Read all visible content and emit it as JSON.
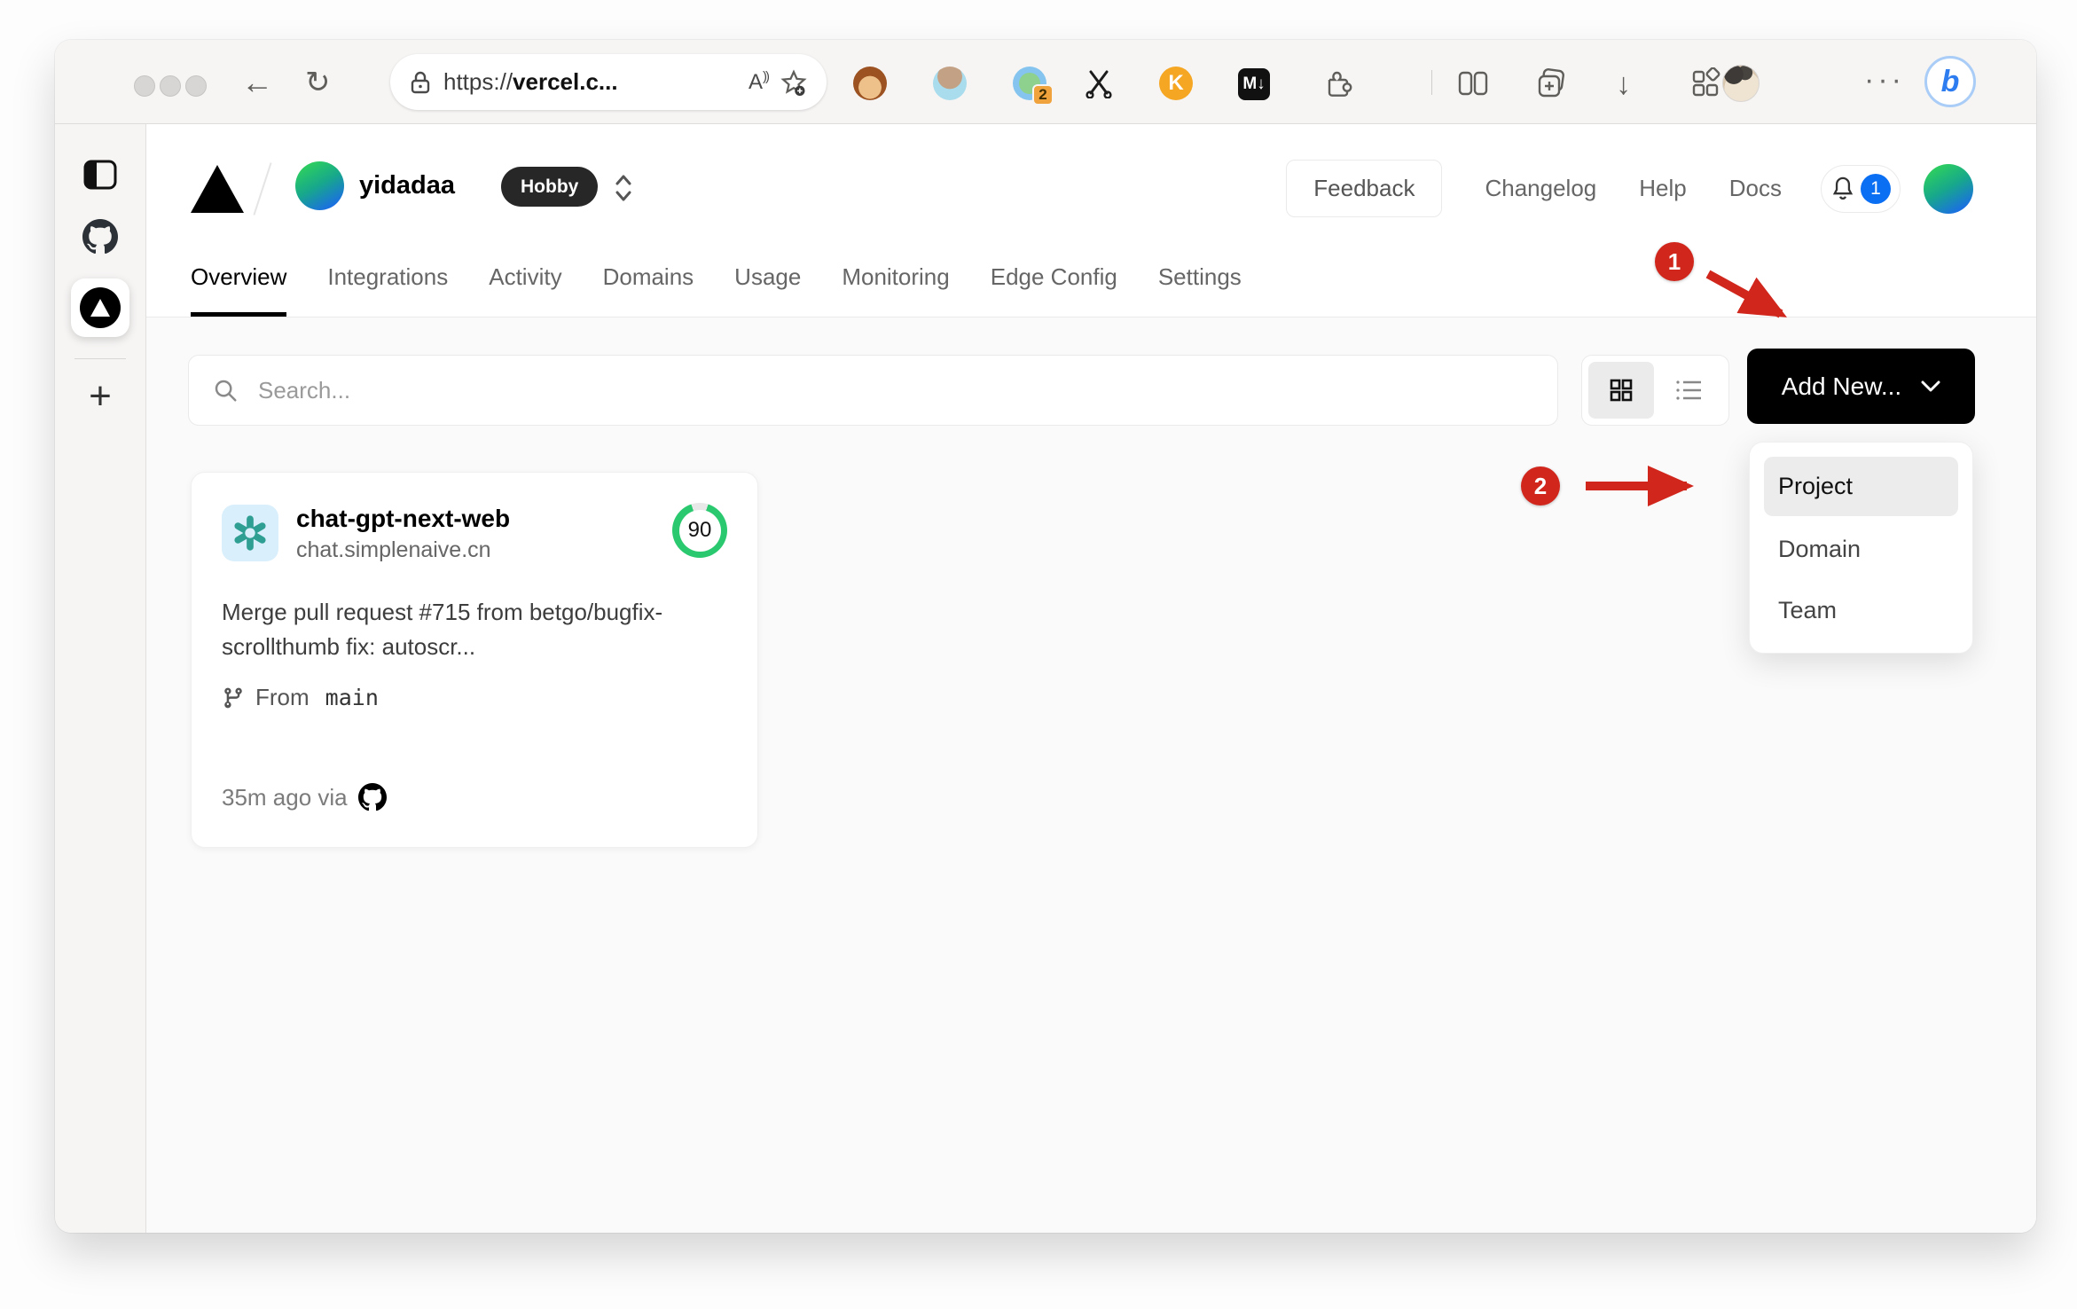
{
  "browser": {
    "url": {
      "scheme": "https://",
      "host_display": "vercel.c..."
    },
    "extensions": {
      "translator_badge": "2",
      "kagi_label": "K",
      "markdown_label": "M↓"
    }
  },
  "header": {
    "team_name": "yidadaa",
    "plan_badge": "Hobby",
    "feedback_label": "Feedback",
    "links": [
      "Changelog",
      "Help",
      "Docs"
    ],
    "notification_count": "1"
  },
  "tabs": [
    {
      "label": "Overview",
      "active": true
    },
    {
      "label": "Integrations",
      "active": false
    },
    {
      "label": "Activity",
      "active": false
    },
    {
      "label": "Domains",
      "active": false
    },
    {
      "label": "Usage",
      "active": false
    },
    {
      "label": "Monitoring",
      "active": false
    },
    {
      "label": "Edge Config",
      "active": false
    },
    {
      "label": "Settings",
      "active": false
    }
  ],
  "controls": {
    "search_placeholder": "Search...",
    "add_new_label": "Add New..."
  },
  "menu": {
    "items": [
      {
        "label": "Project",
        "active": true
      },
      {
        "label": "Domain",
        "active": false
      },
      {
        "label": "Team",
        "active": false
      }
    ]
  },
  "project_card": {
    "name": "chat-gpt-next-web",
    "domain": "chat.simplenaive.cn",
    "score": "90",
    "commit_message": "Merge pull request #715 from betgo/bugfix-scrollthumb fix: autoscr...",
    "branch_label": "From",
    "branch_name": "main",
    "deploy_meta": "35m ago via"
  },
  "annotations": {
    "step1": "1",
    "step2": "2"
  },
  "colors": {
    "annotation_red": "#d0261c",
    "score_green": "#2bc96f",
    "notification_blue": "#0b6ff3",
    "button_black": "#000000"
  }
}
